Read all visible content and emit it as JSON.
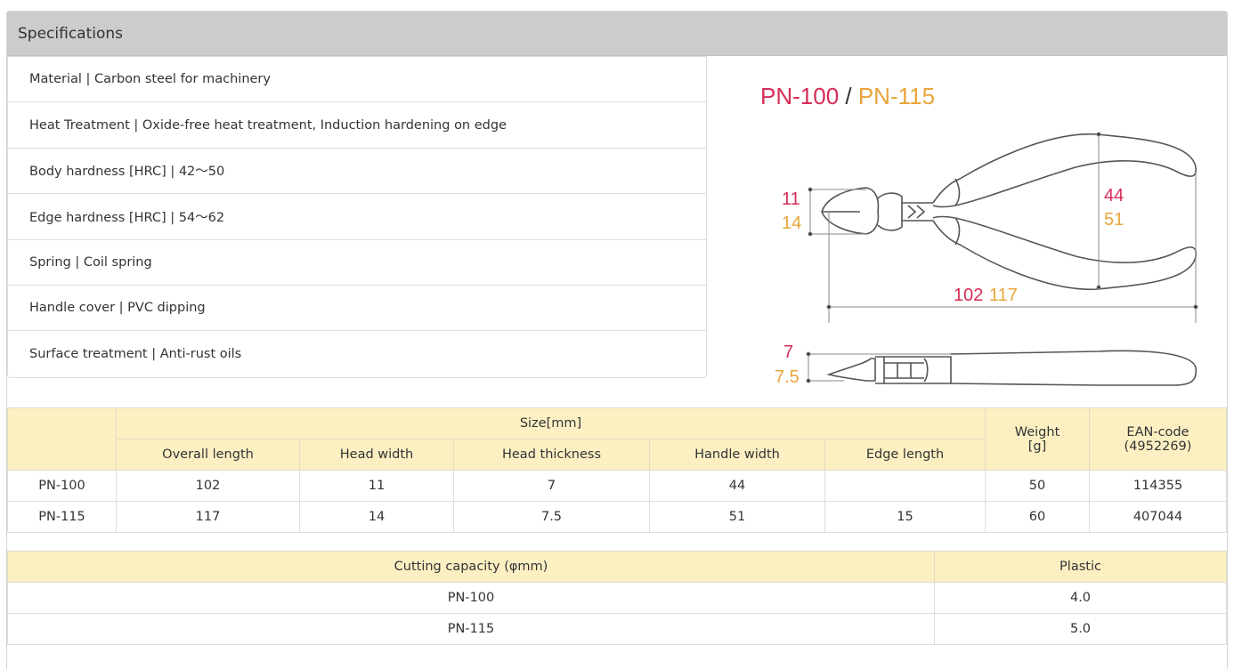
{
  "panel": {
    "heading": "Specifications"
  },
  "specs": [
    "Material | Carbon steel for machinery",
    "Heat Treatment | Oxide-free heat treatment, Induction hardening on edge",
    "Body hardness [HRC] | 42～50",
    "Edge hardness [HRC] | 54～62",
    "Spring | Coil spring",
    "Handle cover | PVC dipping",
    "Surface treatment | Anti-rust oils"
  ],
  "drawing": {
    "title_a": "PN-100",
    "title_sep": " / ",
    "title_b": "PN-115",
    "head_width_a": "11",
    "head_width_b": "14",
    "handle_width_a": "44",
    "handle_width_b": "51",
    "length_a": "102",
    "length_b": "117",
    "thickness_a": "7",
    "thickness_b": "7.5",
    "colors": {
      "pn100": "#d62c56",
      "pn115": "#e8a43a"
    }
  },
  "size_table": {
    "group_header": "Size[mm]",
    "weight_header_1": "Weight",
    "weight_header_2": "[g]",
    "ean_header_1": "EAN-code",
    "ean_header_2": "(4952269)",
    "columns": [
      "Overall length",
      "Head width",
      "Head thickness",
      "Handle width",
      "Edge length"
    ],
    "rows": [
      {
        "model": "PN-100",
        "values": [
          "102",
          "11",
          "7",
          "44",
          ""
        ],
        "weight": "50",
        "ean": "114355"
      },
      {
        "model": "PN-115",
        "values": [
          "117",
          "14",
          "7.5",
          "51",
          "15"
        ],
        "weight": "60",
        "ean": "407044"
      }
    ]
  },
  "cut_table": {
    "header_left": "Cutting capacity (φmm)",
    "header_right": "Plastic",
    "rows": [
      {
        "model": "PN-100",
        "plastic": "4.0"
      },
      {
        "model": "PN-115",
        "plastic": "5.0"
      }
    ]
  }
}
